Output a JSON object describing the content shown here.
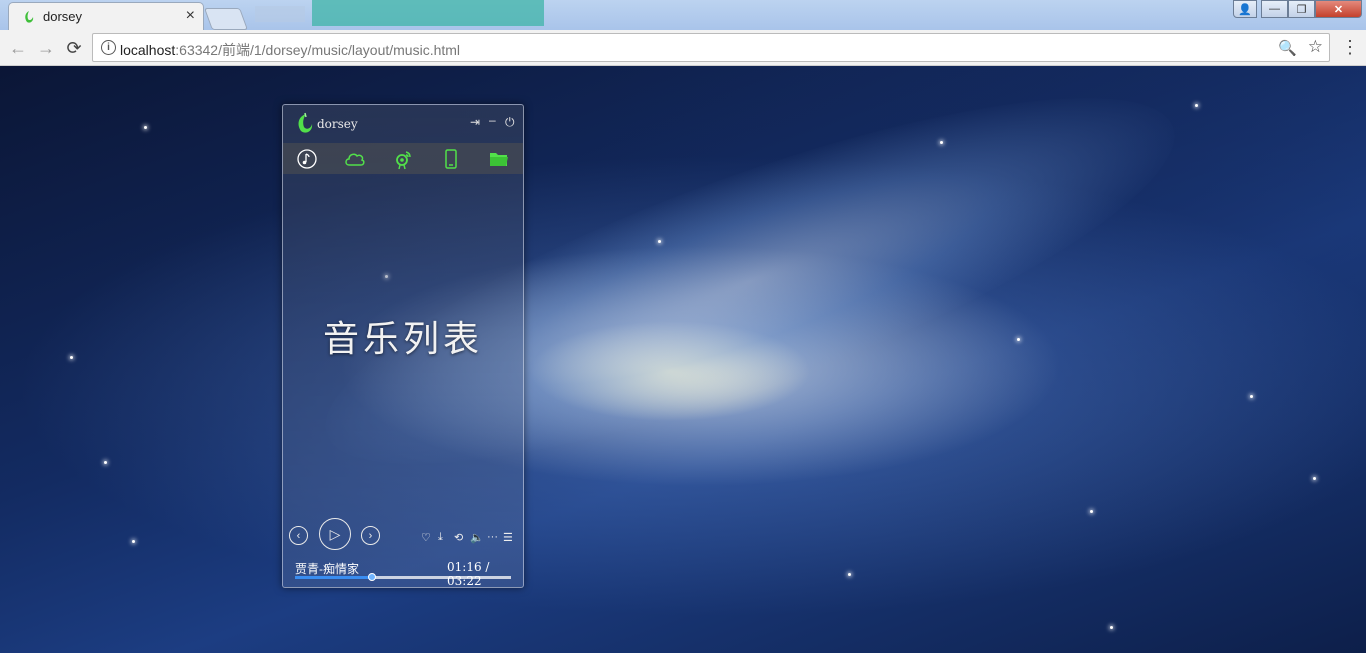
{
  "browser": {
    "tab_title": "dorsey",
    "tab_close": "×",
    "url_host": "localhost",
    "url_rest": ":63342/前端/1/dorsey/music/layout/music.html",
    "info_glyph": "i",
    "nav": {
      "back": "←",
      "forward": "→",
      "reload": "⟳"
    },
    "menu_glyph": "⋮",
    "zoom_glyph": "🔍",
    "star_glyph": "☆",
    "window_controls": {
      "minimize": "—",
      "maximize": "❐",
      "close": "✕",
      "user": "👤"
    }
  },
  "player": {
    "brand": "dorsey",
    "header_buttons": {
      "exit": "⇥",
      "minimize": "–",
      "power": "⏻"
    },
    "nav_icons": [
      {
        "name": "music-note-icon",
        "color": "#ffffff"
      },
      {
        "name": "cloud-icon",
        "color": "#52e04a"
      },
      {
        "name": "radio-icon",
        "color": "#52e04a"
      },
      {
        "name": "phone-icon",
        "color": "#52e04a"
      },
      {
        "name": "folder-icon",
        "color": "#52e04a"
      }
    ],
    "title": "音乐列表",
    "controls": {
      "prev": "‹",
      "play": "▷",
      "next": "›"
    },
    "actions": {
      "like": "♡",
      "download": "⤓",
      "repeat": "⟲",
      "volume": "🔈",
      "more": "···",
      "playlist": "☰"
    },
    "song": "贾青-痴情家",
    "time": "01:16 / 03:22",
    "progress": 0.355,
    "accent_color": "#3a8df0",
    "brand_green": "#52e04a"
  }
}
